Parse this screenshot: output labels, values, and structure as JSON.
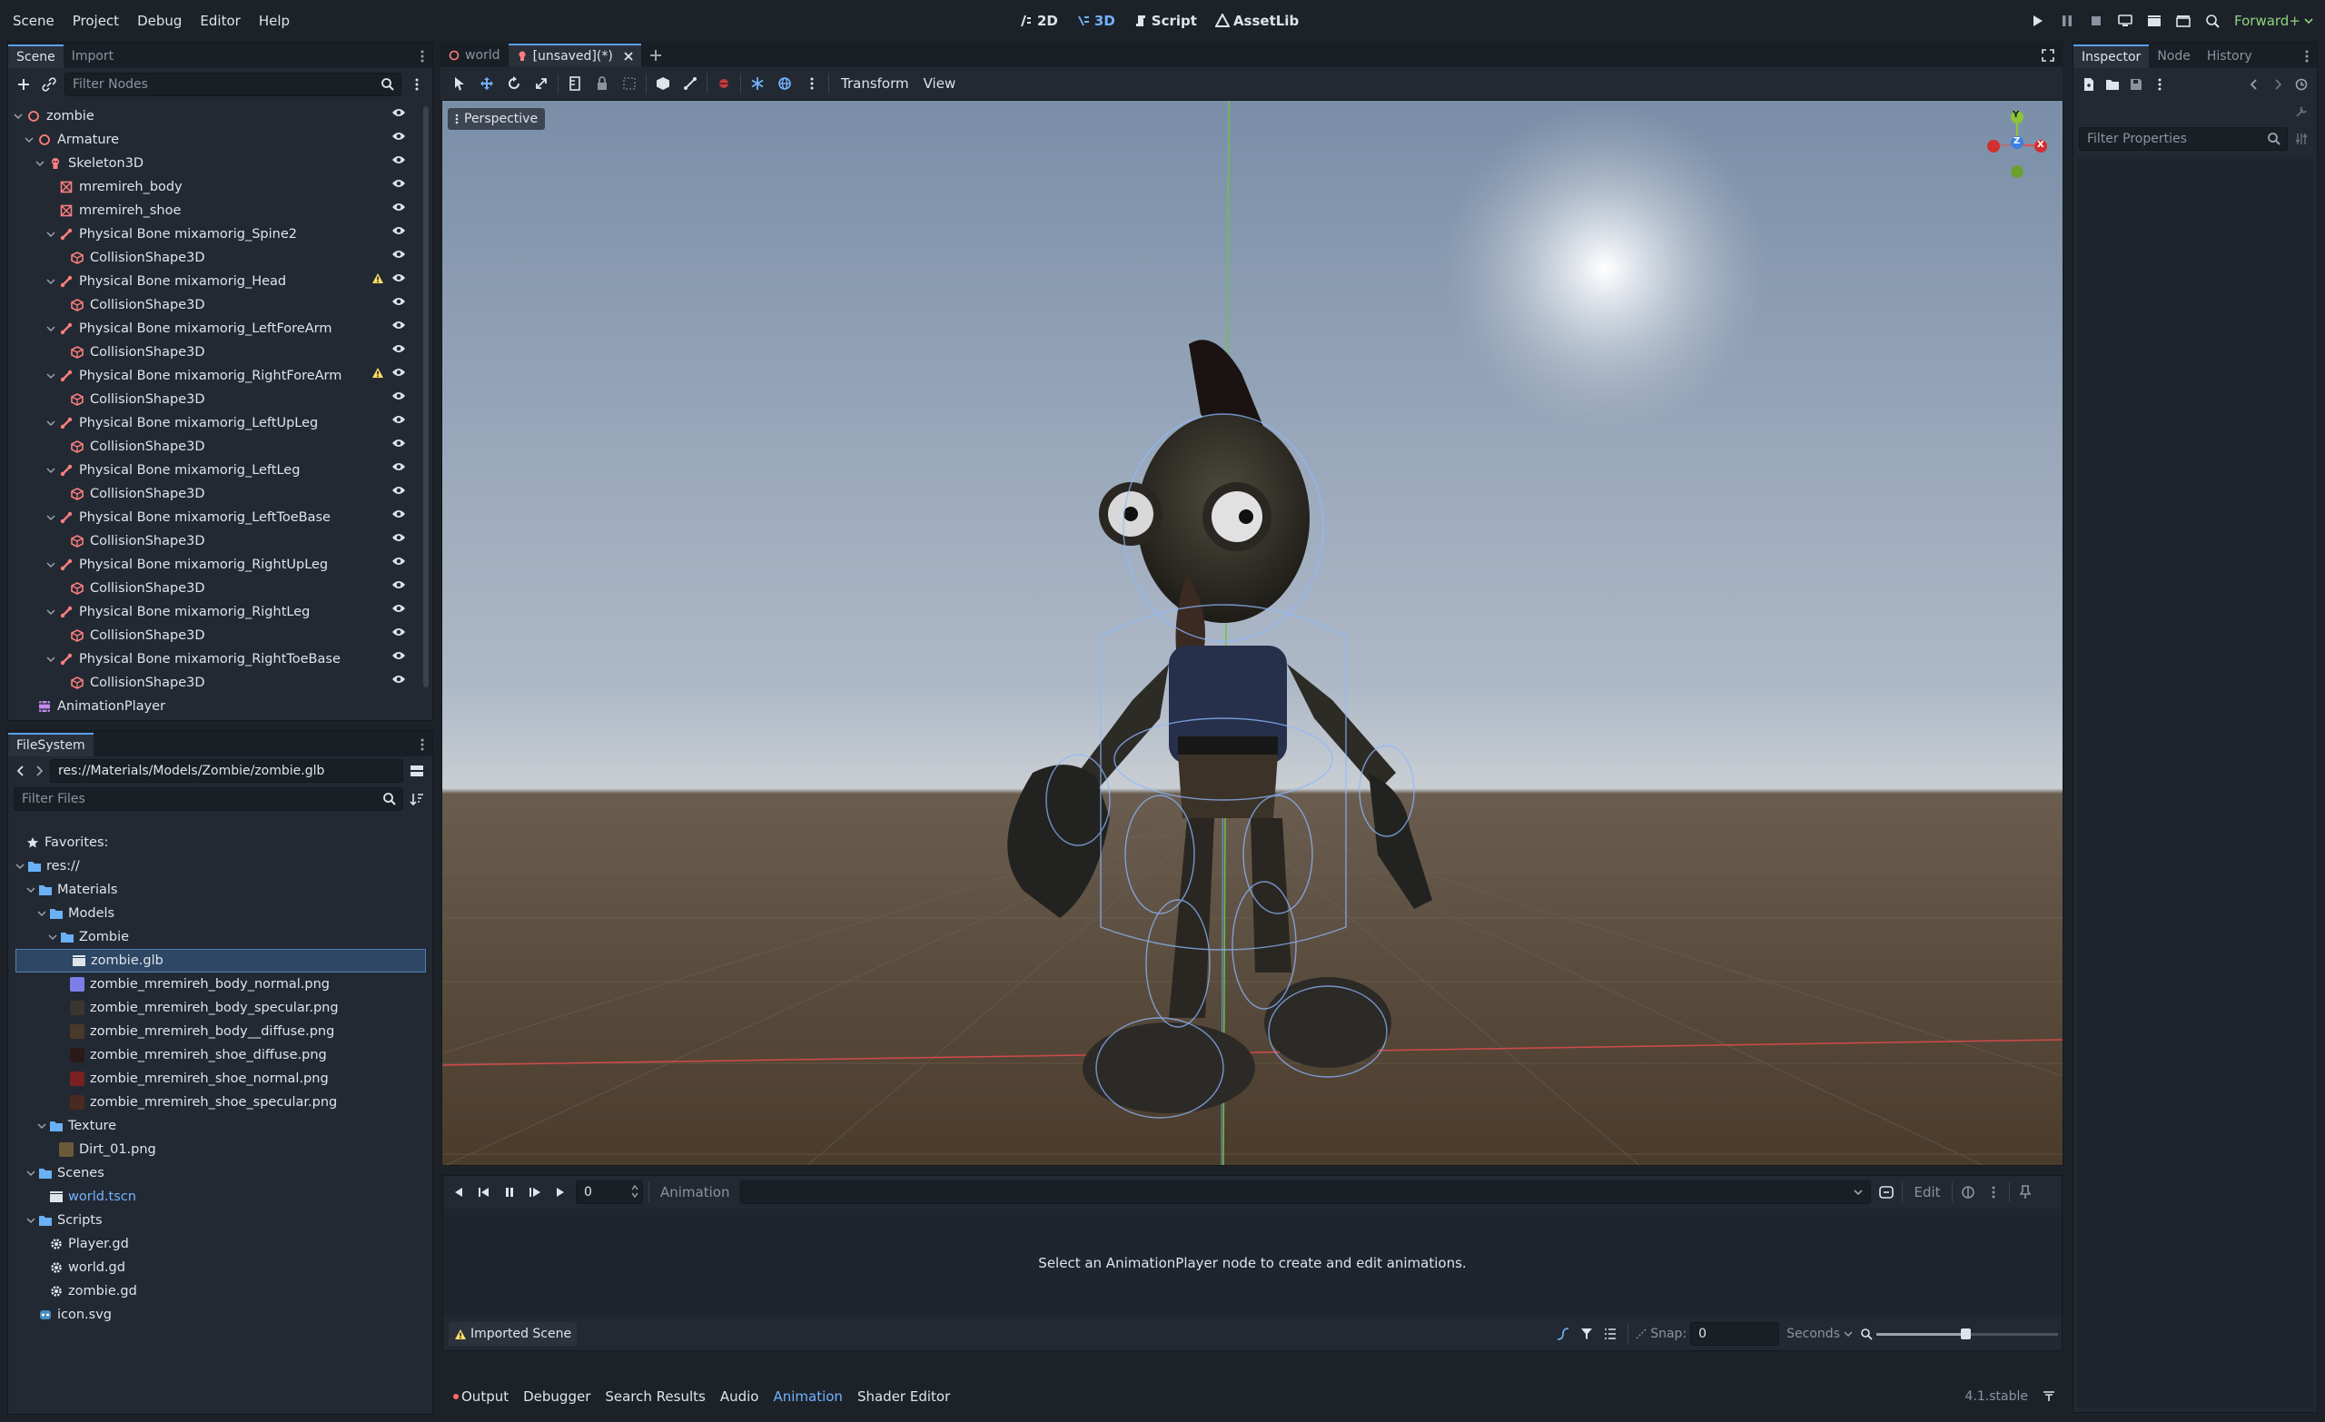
{
  "menu": [
    "Scene",
    "Project",
    "Debug",
    "Editor",
    "Help"
  ],
  "workspaces": [
    {
      "label": "2D",
      "icon": "2d-icon"
    },
    {
      "label": "3D",
      "icon": "3d-icon"
    },
    {
      "label": "Script",
      "icon": "script-icon"
    },
    {
      "label": "AssetLib",
      "icon": "assetlib-icon"
    }
  ],
  "renderer": "Forward+",
  "scene_dock": {
    "tabs": [
      "Scene",
      "Import"
    ],
    "filter_placeholder": "Filter Nodes",
    "nodes": [
      {
        "label": "zombie",
        "depth": 0,
        "icon": "node3d",
        "arrow": "v",
        "warn": false
      },
      {
        "label": "Armature",
        "depth": 1,
        "icon": "node3d",
        "arrow": "v",
        "warn": false
      },
      {
        "label": "Skeleton3D",
        "depth": 2,
        "icon": "skeleton",
        "arrow": "v",
        "warn": false
      },
      {
        "label": "mremireh_body",
        "depth": 3,
        "icon": "mesh",
        "arrow": "",
        "warn": false
      },
      {
        "label": "mremireh_shoe",
        "depth": 3,
        "icon": "mesh",
        "arrow": "",
        "warn": false
      },
      {
        "label": "Physical Bone mixamorig_Spine2",
        "depth": 3,
        "icon": "bone",
        "arrow": "v",
        "warn": false
      },
      {
        "label": "CollisionShape3D",
        "depth": 4,
        "icon": "shape",
        "arrow": "",
        "warn": false
      },
      {
        "label": "Physical Bone mixamorig_Head",
        "depth": 3,
        "icon": "bone",
        "arrow": "v",
        "warn": true
      },
      {
        "label": "CollisionShape3D",
        "depth": 4,
        "icon": "shape",
        "arrow": "",
        "warn": false
      },
      {
        "label": "Physical Bone mixamorig_LeftForeArm",
        "depth": 3,
        "icon": "bone",
        "arrow": "v",
        "warn": false
      },
      {
        "label": "CollisionShape3D",
        "depth": 4,
        "icon": "shape",
        "arrow": "",
        "warn": false
      },
      {
        "label": "Physical Bone mixamorig_RightForeArm",
        "depth": 3,
        "icon": "bone",
        "arrow": "v",
        "warn": true
      },
      {
        "label": "CollisionShape3D",
        "depth": 4,
        "icon": "shape",
        "arrow": "",
        "warn": false
      },
      {
        "label": "Physical Bone mixamorig_LeftUpLeg",
        "depth": 3,
        "icon": "bone",
        "arrow": "v",
        "warn": false
      },
      {
        "label": "CollisionShape3D",
        "depth": 4,
        "icon": "shape",
        "arrow": "",
        "warn": false
      },
      {
        "label": "Physical Bone mixamorig_LeftLeg",
        "depth": 3,
        "icon": "bone",
        "arrow": "v",
        "warn": false
      },
      {
        "label": "CollisionShape3D",
        "depth": 4,
        "icon": "shape",
        "arrow": "",
        "warn": false
      },
      {
        "label": "Physical Bone mixamorig_LeftToeBase",
        "depth": 3,
        "icon": "bone",
        "arrow": "v",
        "warn": false
      },
      {
        "label": "CollisionShape3D",
        "depth": 4,
        "icon": "shape",
        "arrow": "",
        "warn": false
      },
      {
        "label": "Physical Bone mixamorig_RightUpLeg",
        "depth": 3,
        "icon": "bone",
        "arrow": "v",
        "warn": false
      },
      {
        "label": "CollisionShape3D",
        "depth": 4,
        "icon": "shape",
        "arrow": "",
        "warn": false
      },
      {
        "label": "Physical Bone mixamorig_RightLeg",
        "depth": 3,
        "icon": "bone",
        "arrow": "v",
        "warn": false
      },
      {
        "label": "CollisionShape3D",
        "depth": 4,
        "icon": "shape",
        "arrow": "",
        "warn": false
      },
      {
        "label": "Physical Bone mixamorig_RightToeBase",
        "depth": 3,
        "icon": "bone",
        "arrow": "v",
        "warn": false
      },
      {
        "label": "CollisionShape3D",
        "depth": 4,
        "icon": "shape",
        "arrow": "",
        "warn": false
      },
      {
        "label": "AnimationPlayer",
        "depth": 1,
        "icon": "anim",
        "arrow": "",
        "warn": false
      }
    ]
  },
  "filesystem": {
    "tab": "FileSystem",
    "path": "res://Materials/Models/Zombie/zombie.glb",
    "filter_placeholder": "Filter Files",
    "favorites_label": "Favorites:",
    "items": [
      {
        "label": "res://",
        "depth": 0,
        "type": "folder",
        "arrow": "v"
      },
      {
        "label": "Materials",
        "depth": 1,
        "type": "folder",
        "arrow": "v"
      },
      {
        "label": "Models",
        "depth": 2,
        "type": "folder",
        "arrow": "v"
      },
      {
        "label": "Zombie",
        "depth": 3,
        "type": "folder",
        "arrow": "v"
      },
      {
        "label": "zombie.glb",
        "depth": 4,
        "type": "scene",
        "arrow": "",
        "selected": true
      },
      {
        "label": "zombie_mremireh_body_normal.png",
        "depth": 4,
        "type": "img",
        "swatch": "#7e7ee8",
        "arrow": ""
      },
      {
        "label": "zombie_mremireh_body_specular.png",
        "depth": 4,
        "type": "img",
        "swatch": "#3a3530",
        "arrow": ""
      },
      {
        "label": "zombie_mremireh_body__diffuse.png",
        "depth": 4,
        "type": "img",
        "swatch": "#4a3a2a",
        "arrow": ""
      },
      {
        "label": "zombie_mremireh_shoe_diffuse.png",
        "depth": 4,
        "type": "img",
        "swatch": "#2a1a18",
        "arrow": ""
      },
      {
        "label": "zombie_mremireh_shoe_normal.png",
        "depth": 4,
        "type": "img",
        "swatch": "#7a2020",
        "arrow": ""
      },
      {
        "label": "zombie_mremireh_shoe_specular.png",
        "depth": 4,
        "type": "img",
        "swatch": "#4a2a20",
        "arrow": ""
      },
      {
        "label": "Texture",
        "depth": 2,
        "type": "folder",
        "arrow": "v"
      },
      {
        "label": "Dirt_01.png",
        "depth": 3,
        "type": "img",
        "swatch": "#6a5a3a",
        "arrow": ""
      },
      {
        "label": "Scenes",
        "depth": 1,
        "type": "folder",
        "arrow": "v"
      },
      {
        "label": "world.tscn",
        "depth": 2,
        "type": "scene",
        "arrow": "",
        "link": true
      },
      {
        "label": "Scripts",
        "depth": 1,
        "type": "folder",
        "arrow": "v"
      },
      {
        "label": "Player.gd",
        "depth": 2,
        "type": "gear",
        "arrow": ""
      },
      {
        "label": "world.gd",
        "depth": 2,
        "type": "gear",
        "arrow": ""
      },
      {
        "label": "zombie.gd",
        "depth": 2,
        "type": "gear",
        "arrow": ""
      },
      {
        "label": "icon.svg",
        "depth": 1,
        "type": "godot",
        "arrow": ""
      }
    ]
  },
  "editor_tabs": [
    {
      "label": "world",
      "active": false,
      "icon": "node3d-icon"
    },
    {
      "label": "[unsaved](*)",
      "active": true,
      "icon": "skeleton-icon"
    }
  ],
  "viewport": {
    "menu_transform": "Transform",
    "menu_view": "View",
    "perspective_label": "Perspective",
    "gizmo": {
      "y": "Y",
      "z": "Z",
      "x": "X"
    }
  },
  "animation_panel": {
    "time_value": "0",
    "animation_label": "Animation",
    "edit_label": "Edit",
    "message": "Select an AnimationPlayer node to create and edit animations.",
    "imported_scene_label": "Imported Scene",
    "snap_label": "Snap:",
    "snap_value": "0",
    "seconds_label": "Seconds"
  },
  "bottom_tabs": [
    {
      "label": "Output",
      "active": false,
      "dot": true
    },
    {
      "label": "Debugger",
      "active": false
    },
    {
      "label": "Search Results",
      "active": false
    },
    {
      "label": "Audio",
      "active": false
    },
    {
      "label": "Animation",
      "active": true
    },
    {
      "label": "Shader Editor",
      "active": false
    }
  ],
  "version": "4.1.stable",
  "inspector": {
    "tabs": [
      "Inspector",
      "Node",
      "History"
    ],
    "filter_placeholder": "Filter Properties"
  },
  "colors": {
    "accent": "#5aa0f2",
    "node_red": "#fc7f7f",
    "warning": "#ffdd65",
    "renderer_green": "#8cd47e"
  }
}
